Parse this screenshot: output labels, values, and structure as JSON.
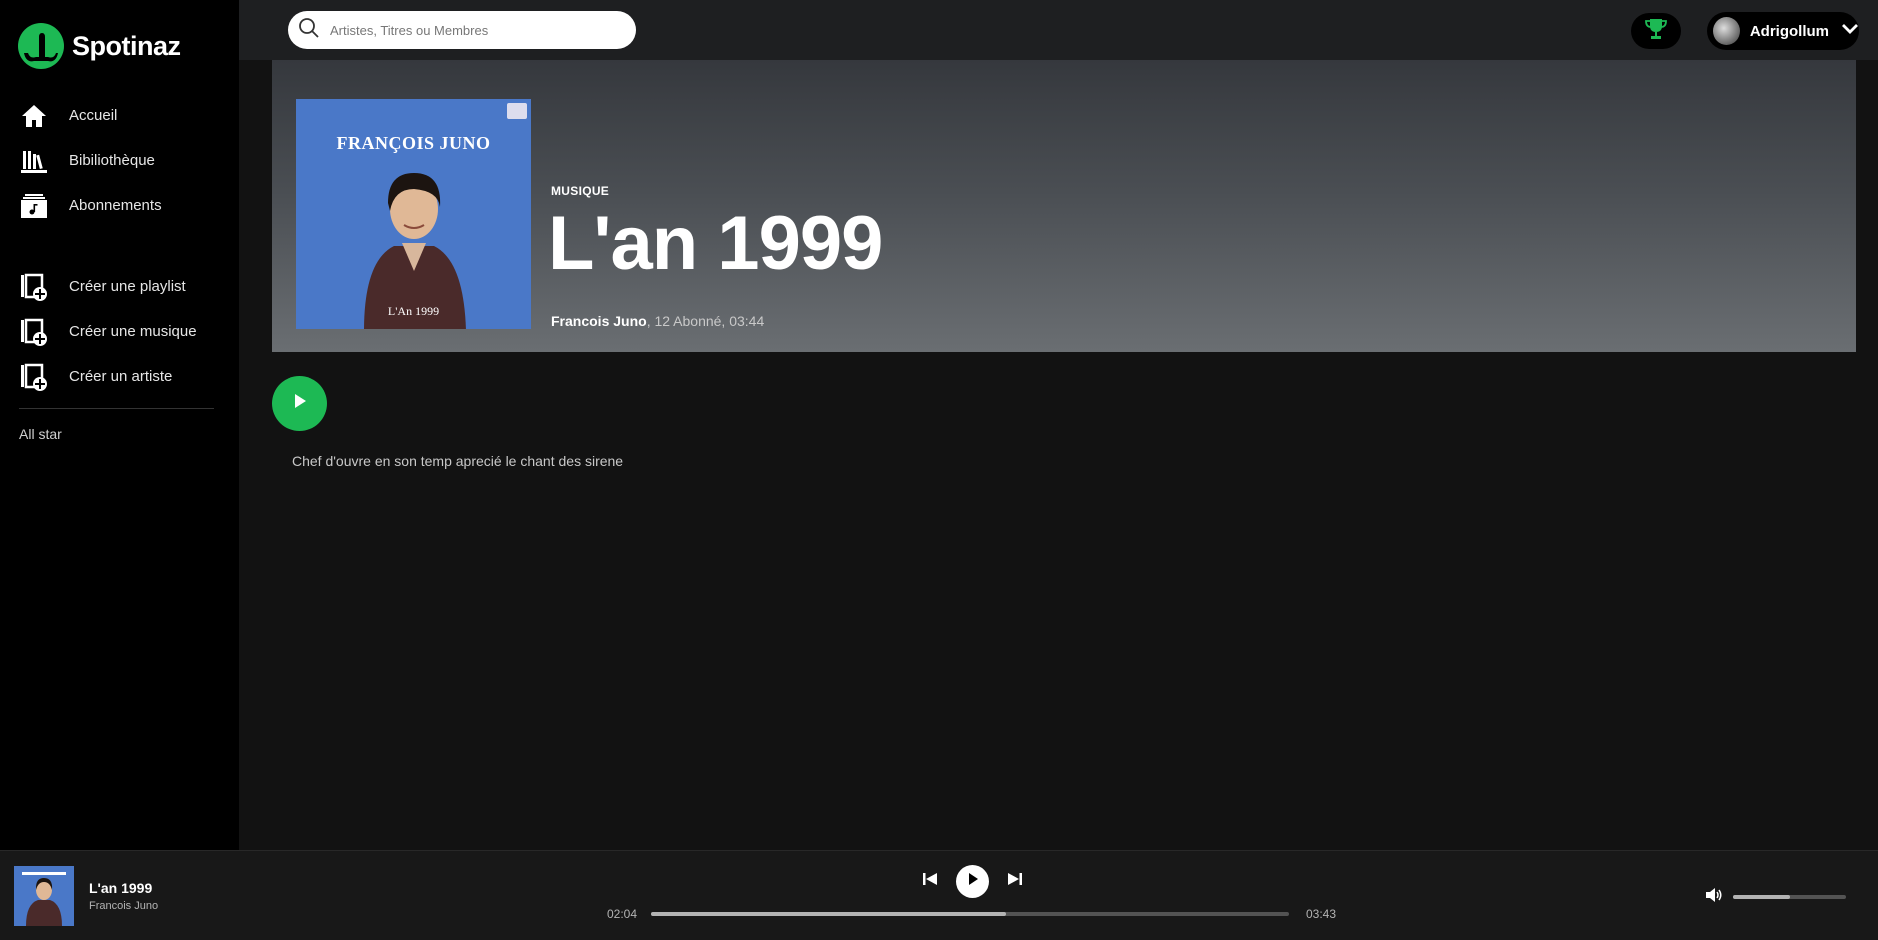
{
  "app": {
    "name": "Spotinaz"
  },
  "sidebar": {
    "main": [
      {
        "label": "Accueil",
        "icon": "home-icon"
      },
      {
        "label": "Bibiliothèque",
        "icon": "library-icon"
      },
      {
        "label": "Abonnements",
        "icon": "subscriptions-icon"
      }
    ],
    "create": [
      {
        "label": "Créer une playlist",
        "icon": "add-playlist-icon"
      },
      {
        "label": "Créer une musique",
        "icon": "add-music-icon"
      },
      {
        "label": "Créer un artiste",
        "icon": "add-artist-icon"
      }
    ],
    "playlists": [
      "All star"
    ]
  },
  "topbar": {
    "search_placeholder": "Artistes, Titres ou Membres",
    "username": "Adrigollum"
  },
  "track": {
    "type": "MUSIQUE",
    "title": "L'an 1999",
    "artist": "Francois Juno",
    "meta": ", 12 Abonné, 03:44",
    "description": "Chef d'ouvre en son temp aprecié le chant des sirene",
    "cover": {
      "title": "FRANÇOIS JUNO",
      "subtitle": "L'An 1999",
      "color": "#4a78c8"
    }
  },
  "player": {
    "title": "L'an 1999",
    "artist": "Francois Juno",
    "current_time": "02:04",
    "total_time": "03:43",
    "progress_fraction": 0.557,
    "volume_fraction": 0.5
  },
  "colors": {
    "accent": "#1db954",
    "sidebar_bg": "#000000",
    "main_bg": "#121212"
  }
}
